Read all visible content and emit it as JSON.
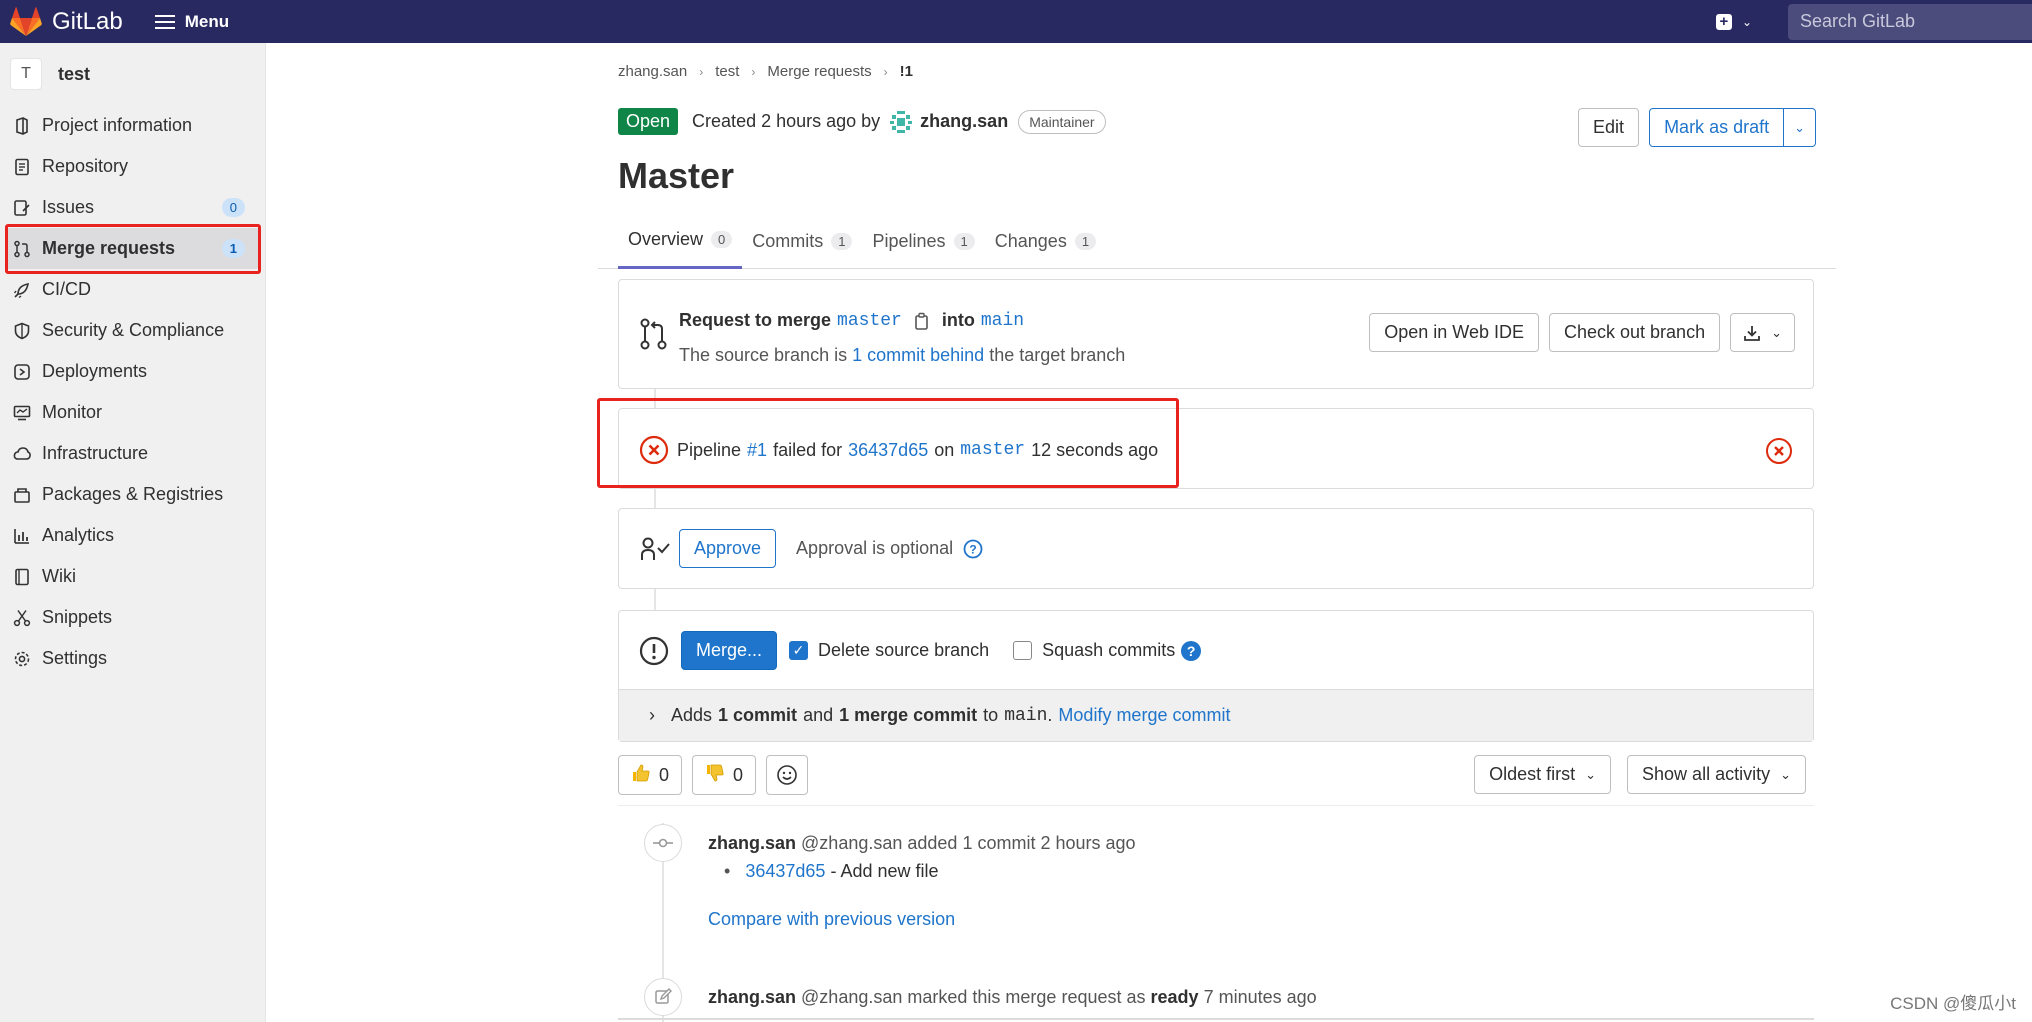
{
  "topbar": {
    "brand": "GitLab",
    "menu_label": "Menu",
    "search_placeholder": "Search GitLab"
  },
  "sidebar": {
    "project_initial": "T",
    "project_name": "test",
    "items": [
      {
        "label": "Project information",
        "icon": "project-icon"
      },
      {
        "label": "Repository",
        "icon": "repository-icon"
      },
      {
        "label": "Issues",
        "icon": "issues-icon",
        "count": "0"
      },
      {
        "label": "Merge requests",
        "icon": "merge-request-icon",
        "count": "1",
        "active": true
      },
      {
        "label": "CI/CD",
        "icon": "rocket-icon"
      },
      {
        "label": "Security & Compliance",
        "icon": "shield-icon"
      },
      {
        "label": "Deployments",
        "icon": "deployments-icon"
      },
      {
        "label": "Monitor",
        "icon": "monitor-icon"
      },
      {
        "label": "Infrastructure",
        "icon": "infrastructure-icon"
      },
      {
        "label": "Packages & Registries",
        "icon": "package-icon"
      },
      {
        "label": "Analytics",
        "icon": "analytics-icon"
      },
      {
        "label": "Wiki",
        "icon": "book-icon"
      },
      {
        "label": "Snippets",
        "icon": "scissors-icon"
      },
      {
        "label": "Settings",
        "icon": "gear-icon"
      }
    ]
  },
  "breadcrumb": [
    "zhang.san",
    "test",
    "Merge requests",
    "!1"
  ],
  "mr": {
    "status": "Open",
    "created_text": "Created 2 hours ago by",
    "author": "zhang.san",
    "role": "Maintainer",
    "edit_label": "Edit",
    "draft_label": "Mark as draft",
    "title": "Master"
  },
  "tabs": [
    {
      "label": "Overview",
      "count": "0"
    },
    {
      "label": "Commits",
      "count": "1"
    },
    {
      "label": "Pipelines",
      "count": "1"
    },
    {
      "label": "Changes",
      "count": "1"
    }
  ],
  "merge_info": {
    "request_label": "Request to merge",
    "source_branch": "master",
    "into_label": "into",
    "target_branch": "main",
    "behind_prefix": "The source branch is",
    "behind_link": "1 commit behind",
    "behind_suffix": "the target branch",
    "web_ide_label": "Open in Web IDE",
    "checkout_label": "Check out branch"
  },
  "pipeline": {
    "prefix": "Pipeline",
    "id": "#1",
    "failed_for": "failed for",
    "sha": "36437d65",
    "on": "on",
    "branch": "master",
    "time": "12 seconds ago"
  },
  "approval": {
    "approve_label": "Approve",
    "optional_text": "Approval is optional"
  },
  "merge": {
    "merge_label": "Merge...",
    "delete_label": "Delete source branch",
    "squash_label": "Squash commits",
    "adds_prefix": "Adds",
    "adds_commit": "1 commit",
    "adds_and": "and",
    "adds_merge_commit": "1 merge commit",
    "adds_to": "to",
    "adds_target": "main",
    "modify_link": "Modify merge commit"
  },
  "reactions": {
    "thumbs_up": "0",
    "thumbs_down": "0"
  },
  "sort": {
    "order_label": "Oldest first",
    "filter_label": "Show all activity"
  },
  "timeline": {
    "e1_author": "zhang.san",
    "e1_handle": "@zhang.san",
    "e1_action": "added 1 commit 2 hours ago",
    "e1_sha": "36437d65",
    "e1_msg": "- Add new file",
    "e1_compare": "Compare with previous version",
    "e2_author": "zhang.san",
    "e2_handle": "@zhang.san",
    "e2_action": "marked this merge request as",
    "e2_state": "ready",
    "e2_time": "7 minutes ago"
  },
  "watermark": "CSDN @傻瓜小t",
  "colors": {
    "topbar": "#292961",
    "link": "#1f75cb",
    "open": "#108548",
    "danger": "#dd2b0e",
    "highlight": "#e8231f"
  }
}
